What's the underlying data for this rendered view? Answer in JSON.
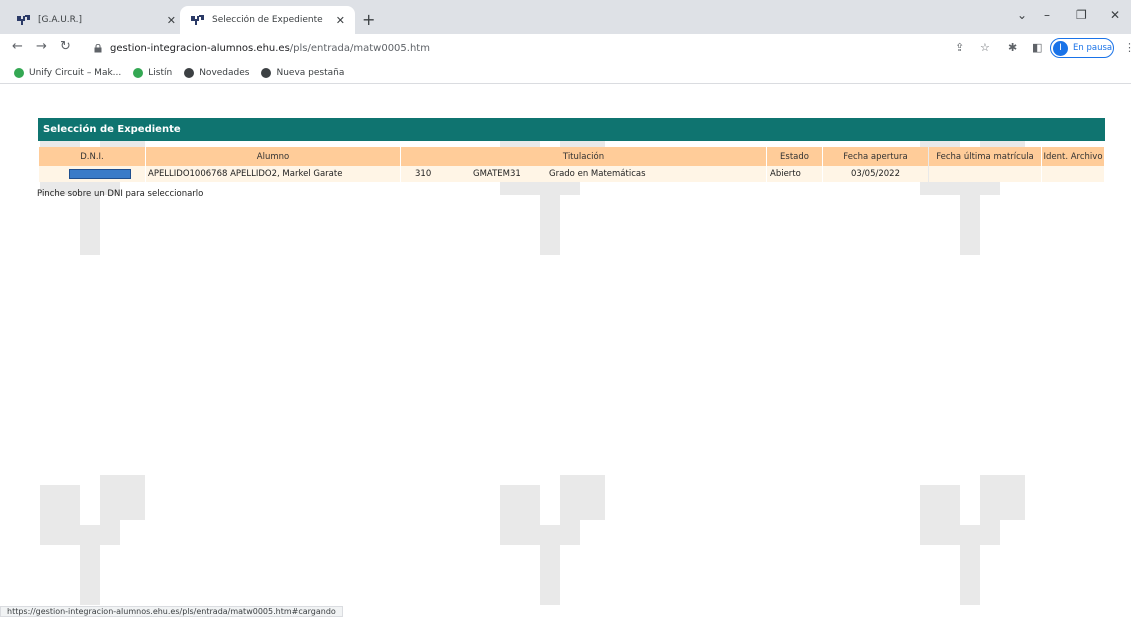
{
  "browser": {
    "tabs": [
      {
        "title": "[G.A.U.R.]",
        "active": false
      },
      {
        "title": "Selección de Expediente",
        "active": true
      }
    ],
    "new_tab": "+",
    "address": {
      "host": "gestion-integracion-alumnos.ehu.es",
      "path": "/pls/entrada/matw0005.htm"
    },
    "profile_label": "En pausa",
    "profile_initial": "I",
    "bookmarks": [
      {
        "label": "Unify Circuit – Mak...",
        "icon": "circuit-icon",
        "color": "#34a853"
      },
      {
        "label": "Listín",
        "icon": "circuit-icon",
        "color": "#34a853"
      },
      {
        "label": "Novedades",
        "icon": "globe-icon",
        "color": "#3c4043"
      },
      {
        "label": "Nueva pestaña",
        "icon": "chrome-icon",
        "color": "#3c4043"
      }
    ],
    "status_url": "https://gestion-integracion-alumnos.ehu.es/pls/entrada/matw0005.htm#cargando"
  },
  "page": {
    "title": "Selección de Expediente",
    "header_color": "#0f7470",
    "columns": {
      "dni": "D.N.I.",
      "alumno": "Alumno",
      "titulacion": "Titulación",
      "estado": "Estado",
      "fecha_apertura": "Fecha apertura",
      "fecha_ultima": "Fecha última matrícula",
      "ident_archivo": "Ident. Archivo"
    },
    "rows": [
      {
        "alumno": "APELLIDO1006768 APELLIDO2, Markel Garate",
        "plan_code": "310",
        "titulacion_code": "GMATEM31",
        "titulacion_name": "Grado en Matemáticas",
        "estado": "Abierto",
        "fecha_apertura": "03/05/2022",
        "fecha_ultima": "",
        "ident_archivo": ""
      }
    ],
    "hint": "Pinche sobre un DNI para seleccionarlo"
  }
}
